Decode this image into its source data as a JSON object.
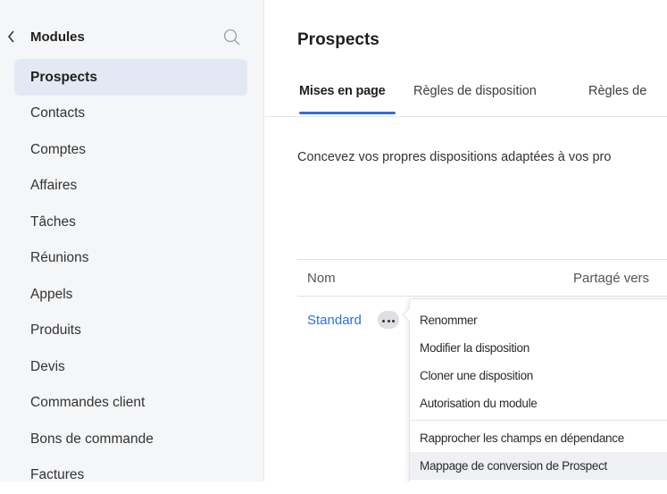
{
  "sidebar": {
    "title": "Modules",
    "items": [
      {
        "label": "Prospects",
        "active": true
      },
      {
        "label": "Contacts"
      },
      {
        "label": "Comptes"
      },
      {
        "label": "Affaires"
      },
      {
        "label": "Tâches"
      },
      {
        "label": "Réunions"
      },
      {
        "label": "Appels"
      },
      {
        "label": "Produits"
      },
      {
        "label": "Devis"
      },
      {
        "label": "Commandes client"
      },
      {
        "label": "Bons de commande"
      },
      {
        "label": "Factures"
      }
    ]
  },
  "main": {
    "title": "Prospects",
    "tabs": [
      {
        "label": "Mises en page",
        "active": true
      },
      {
        "label": "Règles de disposition"
      },
      {
        "label": "Règles de"
      }
    ],
    "description": "Concevez vos propres dispositions adaptées à vos pro",
    "table": {
      "columns": [
        "Nom",
        "Partagé vers"
      ],
      "rows": [
        {
          "name": "Standard"
        }
      ]
    }
  },
  "context_menu": {
    "items": [
      "Renommer",
      "Modifier la disposition",
      "Cloner une disposition",
      "Autorisation du module",
      "Rapprocher les champs en dépendance",
      "Mappage de conversion de Prospect"
    ]
  },
  "colors": {
    "accent": "#2f6fd6",
    "sidebar_bg": "#f5f6f8",
    "active_item_bg": "#e2e9f4"
  }
}
